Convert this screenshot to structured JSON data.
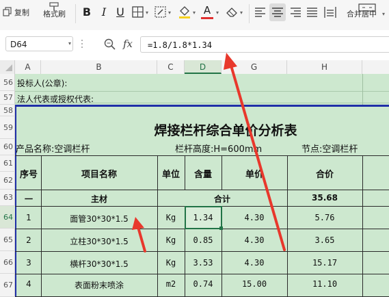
{
  "toolbar": {
    "copy_label": "复制",
    "format_painter_label": "格式刷",
    "merge_center_label": "合并居中",
    "bold": "B",
    "italic": "I",
    "underline": "U",
    "font_color_glyph": "A",
    "accent_color": "#217346",
    "font_color": "#e03030"
  },
  "formula_bar": {
    "name_box": "D64",
    "fx_label": "fx",
    "formula": "=1.8/1.8*1.34"
  },
  "columns": [
    "A",
    "B",
    "C",
    "D",
    "G",
    "H"
  ],
  "selected_column": "D",
  "rows": {
    "r56": "56",
    "r57": "57",
    "r58": "58",
    "r59": "59",
    "r60": "60",
    "r61": "61",
    "r62": "62",
    "r63": "63",
    "r64": "64",
    "r65": "65",
    "r66": "66",
    "r67": "67"
  },
  "sheet": {
    "bidder": "投标人(公章):",
    "legal_rep": "法人代表或授权代表:",
    "title": "焊接栏杆综合单价分析表",
    "product_name": "产品名称:空调栏杆",
    "railing_height": "栏杆高度:H=600mm",
    "node": "节点:空调栏杆",
    "headers": {
      "seq": "序号",
      "item": "项目名称",
      "unit": "单位",
      "qty": "含量",
      "price": "单价",
      "total": "合价"
    },
    "main_row": {
      "seq": "一",
      "item": "主材",
      "subtotal_label": "合计",
      "subtotal": "35.68"
    },
    "items": [
      {
        "seq": "1",
        "name": "面管30*30*1.5",
        "unit": "Kg",
        "qty": "1.34",
        "price": "4.30",
        "total": "5.76"
      },
      {
        "seq": "2",
        "name": "立柱30*30*1.5",
        "unit": "Kg",
        "qty": "0.85",
        "price": "4.30",
        "total": "3.65"
      },
      {
        "seq": "3",
        "name": "横杆30*30*1.5",
        "unit": "Kg",
        "qty": "3.53",
        "price": "4.30",
        "total": "15.17"
      },
      {
        "seq": "4",
        "name": "表面粉末喷涂",
        "unit": "m2",
        "qty": "0.74",
        "price": "15.00",
        "total": "11.10"
      }
    ]
  },
  "annotation_color": "#e8382c"
}
